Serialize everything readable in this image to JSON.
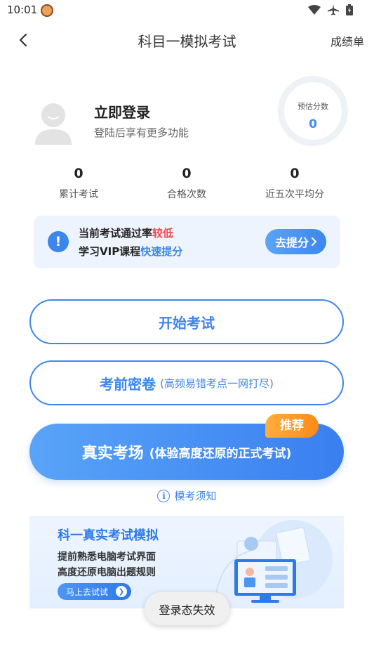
{
  "status_bar": {
    "time": "10:01",
    "icons": [
      "app-notification-icon",
      "wifi-icon",
      "airplane-icon",
      "battery-icon"
    ]
  },
  "nav": {
    "title": "科目一模拟考试",
    "right_label": "成绩单",
    "back_icon": "chevron-left-icon"
  },
  "profile": {
    "title": "立即登录",
    "subtitle": "登陆后享有更多功能",
    "score_label": "预估分数",
    "score_value": "0"
  },
  "stats": [
    {
      "value": "0",
      "label": "累计考试"
    },
    {
      "value": "0",
      "label": "合格次数"
    },
    {
      "value": "0",
      "label": "近五次平均分"
    }
  ],
  "tip": {
    "line1_prefix": "当前考试通过率",
    "line1_highlight": "较低",
    "line2_prefix": "学习VIP课程",
    "line2_highlight": "快速提分",
    "button_label": "去提分",
    "colors": {
      "highlight_red": "#f0474d",
      "accent_blue": "#3d86ee"
    }
  },
  "buttons": {
    "start_exam": "开始考试",
    "secret_paper": "考前密卷",
    "secret_paper_note": "(高频易错考点一网打尽)",
    "real_exam": "真实考场",
    "real_exam_note": "(体验高度还原的正式考试)",
    "recommend_badge": "推荐"
  },
  "notice": {
    "label": "模考须知"
  },
  "promo": {
    "title": "科一真实考试模拟",
    "line1": "提前熟悉电脑考试界面",
    "line2": "高度还原电脑出题规则",
    "button_label": "马上去试试"
  },
  "toast": "登录态失效"
}
